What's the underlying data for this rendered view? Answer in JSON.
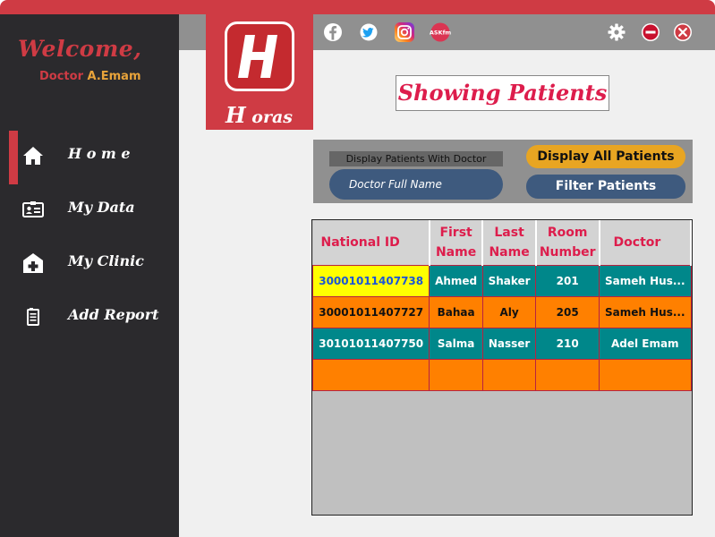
{
  "app": {
    "title": "Horas"
  },
  "colors": {
    "accent": "#cf3b44",
    "sidebar": "#2b2a2d",
    "teal": "#00878a",
    "orange": "#ff8000",
    "navy": "#3e5a7e",
    "gold": "#e8a522"
  },
  "sidebar": {
    "welcome": "Welcome,",
    "doctor_prefix": "Doctor ",
    "doctor_name": "A.Emam",
    "items": [
      {
        "label": "H o m e",
        "icon": "home-icon",
        "active": true
      },
      {
        "label": "My Data",
        "icon": "id-card-icon",
        "active": false
      },
      {
        "label": "My Clinic",
        "icon": "hospital-icon",
        "active": false
      },
      {
        "label": "Add Report",
        "icon": "report-icon",
        "active": false
      }
    ]
  },
  "logo": {
    "letter": "H",
    "brand_first": "H",
    "brand_rest": " oras"
  },
  "social": [
    "facebook-icon",
    "twitter-icon",
    "instagram-icon",
    "askfm-icon"
  ],
  "window_controls": [
    "settings-icon",
    "minimize-icon",
    "close-icon"
  ],
  "main": {
    "title": "Showing Patients",
    "filter_label": "Display Patients With Doctor",
    "doctor_input": {
      "value": "Doctor Full Name",
      "placeholder": "Doctor Full Name"
    },
    "display_all_label": "Display All Patients",
    "filter_button_label": "Filter Patients"
  },
  "table": {
    "columns": [
      {
        "label": "National ID"
      },
      {
        "label": "First\nName"
      },
      {
        "label": "Last\nName"
      },
      {
        "label": "Room\nNumber"
      },
      {
        "label": "Doctor"
      }
    ],
    "rows": [
      {
        "cells": [
          "30001011407738",
          "Ahmed",
          "Shaker",
          "201",
          "Sameh Hus..."
        ],
        "style": "teal",
        "selected_cell": 0
      },
      {
        "cells": [
          "30001011407727",
          "Bahaa",
          "Aly",
          "205",
          "Sameh Hus..."
        ],
        "style": "orange"
      },
      {
        "cells": [
          "30101011407750",
          "Salma",
          "Nasser",
          "210",
          "Adel Emam"
        ],
        "style": "teal"
      },
      {
        "cells": [
          "",
          "",
          "",
          "",
          ""
        ],
        "style": "orange"
      }
    ]
  }
}
